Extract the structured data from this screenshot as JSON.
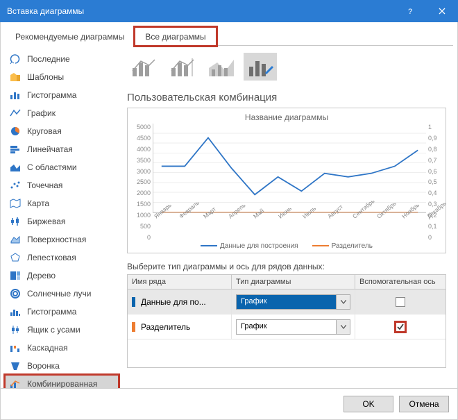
{
  "window": {
    "title": "Вставка диаграммы"
  },
  "tabs": {
    "recommended": "Рекомендуемые диаграммы",
    "all": "Все диаграммы"
  },
  "categories": [
    {
      "label": "Последние",
      "icon": "recent"
    },
    {
      "label": "Шаблоны",
      "icon": "templates"
    },
    {
      "label": "Гистограмма",
      "icon": "column"
    },
    {
      "label": "График",
      "icon": "line"
    },
    {
      "label": "Круговая",
      "icon": "pie"
    },
    {
      "label": "Линейчатая",
      "icon": "bar"
    },
    {
      "label": "С областями",
      "icon": "area"
    },
    {
      "label": "Точечная",
      "icon": "scatter"
    },
    {
      "label": "Карта",
      "icon": "map"
    },
    {
      "label": "Биржевая",
      "icon": "stock"
    },
    {
      "label": "Поверхностная",
      "icon": "surface"
    },
    {
      "label": "Лепестковая",
      "icon": "radar"
    },
    {
      "label": "Дерево",
      "icon": "treemap"
    },
    {
      "label": "Солнечные лучи",
      "icon": "sunburst"
    },
    {
      "label": "Гистограмма",
      "icon": "histogram"
    },
    {
      "label": "Ящик с усами",
      "icon": "boxwhisker"
    },
    {
      "label": "Каскадная",
      "icon": "waterfall"
    },
    {
      "label": "Воронка",
      "icon": "funnel"
    },
    {
      "label": "Комбинированная",
      "icon": "combo"
    }
  ],
  "preview": {
    "title": "Пользовательская комбинация",
    "chart_title": "Название диаграммы",
    "legend": {
      "s1": "Данные для построения",
      "s2": "Разделитель"
    }
  },
  "series_section": {
    "label": "Выберите тип диаграммы и ось для рядов данных:",
    "col_name": "Имя ряда",
    "col_type": "Тип диаграммы",
    "col_axis": "Вспомогательная ось",
    "rows": [
      {
        "name": "Данные для по...",
        "type": "График",
        "axis_checked": false,
        "color": "#0a64ad"
      },
      {
        "name": "Разделитель",
        "type": "График",
        "axis_checked": true,
        "color": "#ed7d31"
      }
    ]
  },
  "buttons": {
    "ok": "OK",
    "cancel": "Отмена"
  },
  "chart_data": {
    "type": "line",
    "title": "Название диаграммы",
    "categories": [
      "Январь",
      "Февраль",
      "Март",
      "Апрель",
      "Май",
      "Июнь",
      "Июль",
      "Август",
      "Сентябрь",
      "Октябрь",
      "Ноябрь",
      "Декабрь"
    ],
    "series": [
      {
        "name": "Данные для построения",
        "axis": "primary",
        "values": [
          2600,
          2600,
          4200,
          2500,
          1000,
          2000,
          1200,
          2200,
          2000,
          2200,
          2600,
          3500
        ]
      },
      {
        "name": "Разделитель",
        "axis": "secondary",
        "values": [
          0,
          0,
          0,
          0,
          0,
          0,
          0,
          0,
          0,
          0,
          0,
          0
        ]
      }
    ],
    "ylabel": "",
    "xlabel": "",
    "ylim": [
      0,
      5000
    ],
    "y2lim": [
      0,
      1
    ],
    "yticks": [
      0,
      500,
      1000,
      1500,
      2000,
      2500,
      3000,
      3500,
      4000,
      4500,
      5000
    ],
    "y2ticks": [
      0,
      0.1,
      0.2,
      0.3,
      0.4,
      0.5,
      0.6,
      0.7,
      0.8,
      0.9,
      1
    ]
  }
}
